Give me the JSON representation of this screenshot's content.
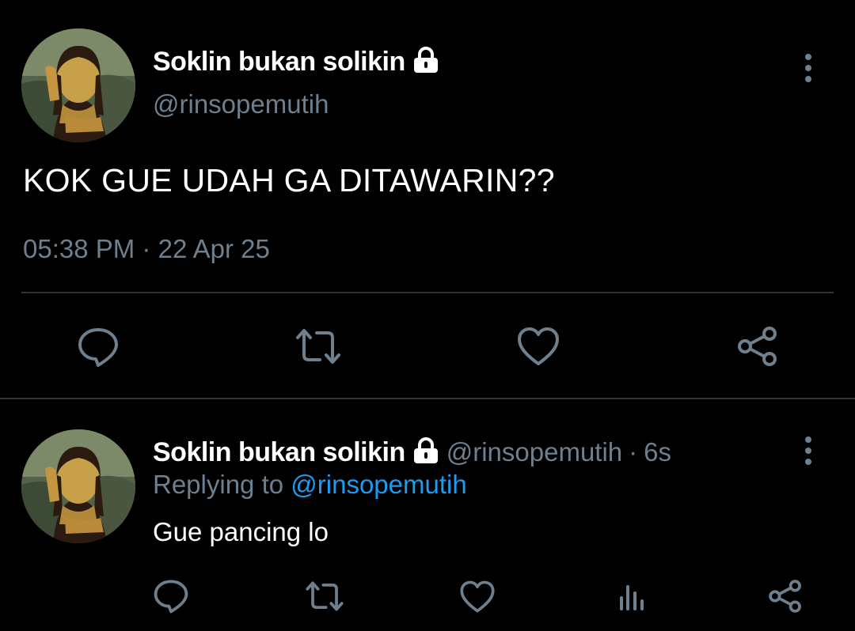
{
  "main_tweet": {
    "display_name": "Soklin bukan solikin",
    "handle": "@rinsopemutih",
    "text": "KOK GUE UDAH GA DITAWARIN??",
    "time": "05:38 PM",
    "separator": "·",
    "date": "22 Apr 25",
    "actions": [
      "reply-icon",
      "retweet-icon",
      "like-icon",
      "share-icon"
    ]
  },
  "reply_tweet": {
    "display_name": "Soklin bukan solikin",
    "handle": "@rinsopemutih",
    "separator": "·",
    "age": "6s",
    "replying_prefix": "Replying to",
    "replying_to": "@rinsopemutih",
    "text": "Gue pancing lo",
    "actions": [
      "reply-icon",
      "retweet-icon",
      "like-icon",
      "analytics-icon",
      "share-icon"
    ]
  },
  "colors": {
    "background": "#000000",
    "text": "#ffffff",
    "muted": "#6e7f8e",
    "link": "#1d9bf0",
    "divider": "#2f3336"
  }
}
